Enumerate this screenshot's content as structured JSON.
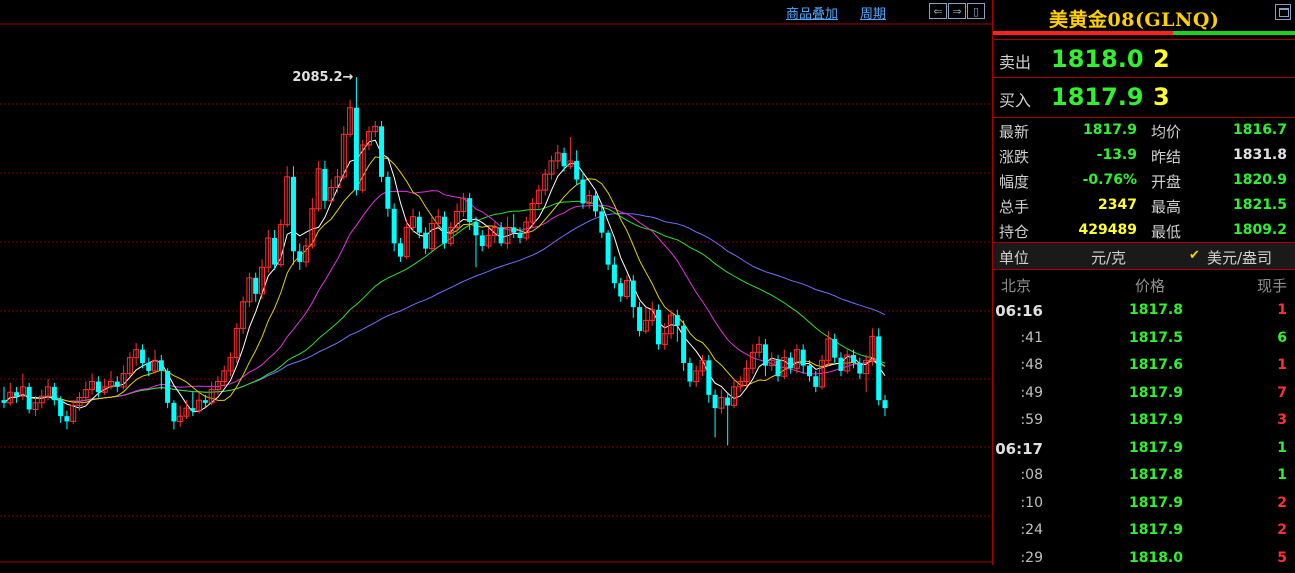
{
  "toolbar": {
    "overlay_label": "商品叠加",
    "period_label": "周期",
    "nav_left": "⇐",
    "nav_right": "⇒",
    "nav_panel": "▯"
  },
  "chart_data": {
    "type": "candlestick",
    "annotation": "2085.2→",
    "annotation_value": 2085.2,
    "ylim": [
      1718,
      2125
    ],
    "colors": {
      "up": "#ff3030",
      "down": "#00ffff",
      "ma5": "#ffffff",
      "ma10": "#e0d000",
      "ma20": "#e030e0",
      "ma40": "#30e030",
      "ma60": "#7070ff"
    },
    "candles": [
      [
        1842,
        1840,
        1852,
        1836
      ],
      [
        1840,
        1848,
        1855,
        1838
      ],
      [
        1848,
        1845,
        1852,
        1840
      ],
      [
        1845,
        1852,
        1862,
        1842
      ],
      [
        1852,
        1835,
        1855,
        1832
      ],
      [
        1835,
        1840,
        1845,
        1830
      ],
      [
        1840,
        1845,
        1850,
        1836
      ],
      [
        1845,
        1852,
        1858,
        1842
      ],
      [
        1852,
        1842,
        1855,
        1838
      ],
      [
        1842,
        1830,
        1845,
        1825
      ],
      [
        1830,
        1826,
        1834,
        1820
      ],
      [
        1826,
        1838,
        1842,
        1824
      ],
      [
        1838,
        1844,
        1848,
        1834
      ],
      [
        1844,
        1850,
        1856,
        1840
      ],
      [
        1850,
        1856,
        1862,
        1846
      ],
      [
        1856,
        1848,
        1860,
        1844
      ],
      [
        1848,
        1852,
        1858,
        1846
      ],
      [
        1852,
        1856,
        1864,
        1850
      ],
      [
        1856,
        1852,
        1860,
        1848
      ],
      [
        1852,
        1862,
        1868,
        1850
      ],
      [
        1862,
        1874,
        1878,
        1860
      ],
      [
        1874,
        1880,
        1885,
        1868
      ],
      [
        1880,
        1870,
        1884,
        1866
      ],
      [
        1870,
        1864,
        1874,
        1860
      ],
      [
        1864,
        1872,
        1880,
        1862
      ],
      [
        1872,
        1864,
        1876,
        1850
      ],
      [
        1864,
        1840,
        1866,
        1836
      ],
      [
        1840,
        1826,
        1842,
        1820
      ],
      [
        1826,
        1830,
        1838,
        1822
      ],
      [
        1830,
        1836,
        1842,
        1828
      ],
      [
        1836,
        1834,
        1848,
        1830
      ],
      [
        1834,
        1842,
        1848,
        1832
      ],
      [
        1842,
        1840,
        1846,
        1836
      ],
      [
        1840,
        1850,
        1856,
        1838
      ],
      [
        1850,
        1856,
        1860,
        1846
      ],
      [
        1856,
        1864,
        1868,
        1852
      ],
      [
        1864,
        1874,
        1878,
        1860
      ],
      [
        1874,
        1896,
        1900,
        1870
      ],
      [
        1896,
        1916,
        1920,
        1892
      ],
      [
        1916,
        1934,
        1938,
        1912
      ],
      [
        1934,
        1922,
        1938,
        1916
      ],
      [
        1922,
        1942,
        1948,
        1918
      ],
      [
        1942,
        1964,
        1970,
        1938
      ],
      [
        1964,
        1944,
        1970,
        1940
      ],
      [
        1944,
        1974,
        1978,
        1942
      ],
      [
        1974,
        2010,
        2018,
        1972
      ],
      [
        2010,
        1954,
        2018,
        1944
      ],
      [
        1954,
        1946,
        1960,
        1940
      ],
      [
        1946,
        1958,
        1964,
        1942
      ],
      [
        1958,
        1986,
        1994,
        1956
      ],
      [
        1986,
        2016,
        2022,
        1984
      ],
      [
        2016,
        1992,
        2022,
        1986
      ],
      [
        1992,
        2002,
        2008,
        1990
      ],
      [
        2002,
        2010,
        2016,
        1998
      ],
      [
        2010,
        2042,
        2048,
        2008
      ],
      [
        2042,
        2062,
        2068,
        2040
      ],
      [
        2062,
        2000,
        2085,
        1996
      ],
      [
        2000,
        2034,
        2038,
        1998
      ],
      [
        2034,
        2044,
        2048,
        2030
      ],
      [
        2044,
        2048,
        2052,
        2040
      ],
      [
        2048,
        2010,
        2052,
        2006
      ],
      [
        2010,
        1986,
        2014,
        1980
      ],
      [
        1986,
        1960,
        1990,
        1954
      ],
      [
        1960,
        1950,
        1964,
        1946
      ],
      [
        1950,
        1972,
        1978,
        1948
      ],
      [
        1972,
        1980,
        1986,
        1968
      ],
      [
        1980,
        1968,
        1984,
        1964
      ],
      [
        1968,
        1956,
        1972,
        1952
      ],
      [
        1956,
        1975,
        1980,
        1954
      ],
      [
        1975,
        1980,
        1986,
        1972
      ],
      [
        1980,
        1960,
        1984,
        1956
      ],
      [
        1960,
        1972,
        1976,
        1958
      ],
      [
        1972,
        1984,
        1990,
        1968
      ],
      [
        1984,
        1994,
        1998,
        1980
      ],
      [
        1994,
        1976,
        1998,
        1970
      ],
      [
        1976,
        1966,
        1980,
        1942
      ],
      [
        1966,
        1958,
        1970,
        1954
      ],
      [
        1958,
        1966,
        1972,
        1956
      ],
      [
        1966,
        1972,
        1976,
        1960
      ],
      [
        1972,
        1960,
        1976,
        1958
      ],
      [
        1960,
        1972,
        1980,
        1956
      ],
      [
        1972,
        1968,
        1982,
        1964
      ],
      [
        1968,
        1964,
        1972,
        1960
      ],
      [
        1964,
        1976,
        1980,
        1962
      ],
      [
        1976,
        1990,
        1994,
        1972
      ],
      [
        1990,
        2000,
        2004,
        1986
      ],
      [
        2000,
        2012,
        2016,
        1996
      ],
      [
        2012,
        2022,
        2026,
        2008
      ],
      [
        2022,
        2028,
        2034,
        2016
      ],
      [
        2028,
        2018,
        2032,
        2014
      ],
      [
        2018,
        2022,
        2040,
        2016
      ],
      [
        2022,
        2008,
        2030,
        2004
      ],
      [
        2008,
        1990,
        2014,
        1986
      ],
      [
        1990,
        1996,
        2000,
        1986
      ],
      [
        1996,
        1984,
        2000,
        1980
      ],
      [
        1984,
        1968,
        1990,
        1964
      ],
      [
        1968,
        1944,
        1970,
        1940
      ],
      [
        1944,
        1930,
        1950,
        1926
      ],
      [
        1930,
        1920,
        1934,
        1916
      ],
      [
        1920,
        1932,
        1936,
        1918
      ],
      [
        1932,
        1912,
        1936,
        1904
      ],
      [
        1912,
        1894,
        1916,
        1890
      ],
      [
        1894,
        1902,
        1912,
        1892
      ],
      [
        1902,
        1910,
        1916,
        1898
      ],
      [
        1910,
        1884,
        1914,
        1880
      ],
      [
        1884,
        1892,
        1900,
        1880
      ],
      [
        1892,
        1906,
        1910,
        1888
      ],
      [
        1906,
        1898,
        1910,
        1886
      ],
      [
        1898,
        1870,
        1902,
        1864
      ],
      [
        1870,
        1856,
        1874,
        1852
      ],
      [
        1856,
        1864,
        1868,
        1852
      ],
      [
        1864,
        1872,
        1876,
        1860
      ],
      [
        1872,
        1846,
        1876,
        1840
      ],
      [
        1846,
        1836,
        1850,
        1814
      ],
      [
        1836,
        1844,
        1850,
        1832
      ],
      [
        1844,
        1838,
        1848,
        1808
      ],
      [
        1838,
        1852,
        1858,
        1836
      ],
      [
        1852,
        1856,
        1860,
        1848
      ],
      [
        1856,
        1866,
        1872,
        1852
      ],
      [
        1866,
        1878,
        1884,
        1862
      ],
      [
        1878,
        1884,
        1890,
        1874
      ],
      [
        1884,
        1868,
        1888,
        1860
      ],
      [
        1868,
        1872,
        1878,
        1864
      ],
      [
        1872,
        1860,
        1876,
        1856
      ],
      [
        1860,
        1874,
        1880,
        1858
      ],
      [
        1874,
        1866,
        1878,
        1862
      ],
      [
        1866,
        1880,
        1884,
        1862
      ],
      [
        1880,
        1868,
        1884,
        1862
      ],
      [
        1868,
        1860,
        1872,
        1856
      ],
      [
        1860,
        1852,
        1864,
        1848
      ],
      [
        1852,
        1872,
        1876,
        1850
      ],
      [
        1872,
        1888,
        1894,
        1868
      ],
      [
        1888,
        1874,
        1892,
        1870
      ],
      [
        1874,
        1864,
        1878,
        1860
      ],
      [
        1864,
        1876,
        1880,
        1862
      ],
      [
        1876,
        1870,
        1880,
        1866
      ],
      [
        1870,
        1862,
        1874,
        1858
      ],
      [
        1862,
        1872,
        1876,
        1848
      ],
      [
        1872,
        1890,
        1896,
        1868
      ],
      [
        1890,
        1842,
        1896,
        1838
      ],
      [
        1842,
        1836,
        1846,
        1830
      ]
    ]
  },
  "panel": {
    "title": "美黄金08(GLNQ)",
    "ask_label": "卖出",
    "ask_price": "1818.0",
    "ask_vol": "2",
    "bid_label": "买入",
    "bid_price": "1817.9",
    "bid_vol": "3",
    "stats": [
      {
        "l1": "最新",
        "v1": "1817.9",
        "c1": "#30f030",
        "l2": "均价",
        "v2": "1816.7",
        "c2": "#30f030"
      },
      {
        "l1": "涨跌",
        "v1": "-13.9",
        "c1": "#30f030",
        "l2": "昨结",
        "v2": "1831.8",
        "c2": "#e0e0e0"
      },
      {
        "l1": "幅度",
        "v1": "-0.76%",
        "c1": "#30f030",
        "l2": "开盘",
        "v2": "1820.9",
        "c2": "#30f030"
      },
      {
        "l1": "总手",
        "v1": "2347",
        "c1": "#ffff30",
        "l2": "最高",
        "v2": "1821.5",
        "c2": "#30f030"
      },
      {
        "l1": "持仓",
        "v1": "429489",
        "c1": "#ffff30",
        "l2": "最低",
        "v2": "1809.2",
        "c2": "#30f030"
      }
    ],
    "unit_label": "单位",
    "unit_value": "元/克",
    "unit_check": "✔",
    "unit_alt": "美元/盎司",
    "ticks_head": {
      "time": "北京",
      "price": "价格",
      "qty": "现手"
    },
    "ticks": [
      {
        "t": "06:16",
        "big": true,
        "p": "1817.8",
        "q": "1",
        "qc": "#ff3030"
      },
      {
        "t": ":41",
        "big": false,
        "p": "1817.5",
        "q": "6",
        "qc": "#30f030"
      },
      {
        "t": ":48",
        "big": false,
        "p": "1817.6",
        "q": "1",
        "qc": "#ff3030"
      },
      {
        "t": ":49",
        "big": false,
        "p": "1817.9",
        "q": "7",
        "qc": "#ff3030"
      },
      {
        "t": ":59",
        "big": false,
        "p": "1817.9",
        "q": "3",
        "qc": "#ff3030"
      },
      {
        "t": "06:17",
        "big": true,
        "p": "1817.9",
        "q": "1",
        "qc": "#30f030"
      },
      {
        "t": ":08",
        "big": false,
        "p": "1817.8",
        "q": "1",
        "qc": "#30f030"
      },
      {
        "t": ":10",
        "big": false,
        "p": "1817.9",
        "q": "2",
        "qc": "#ff3030"
      },
      {
        "t": ":24",
        "big": false,
        "p": "1817.9",
        "q": "2",
        "qc": "#ff3030"
      },
      {
        "t": ":29",
        "big": false,
        "p": "1818.0",
        "q": "5",
        "qc": "#ff3030"
      }
    ]
  }
}
